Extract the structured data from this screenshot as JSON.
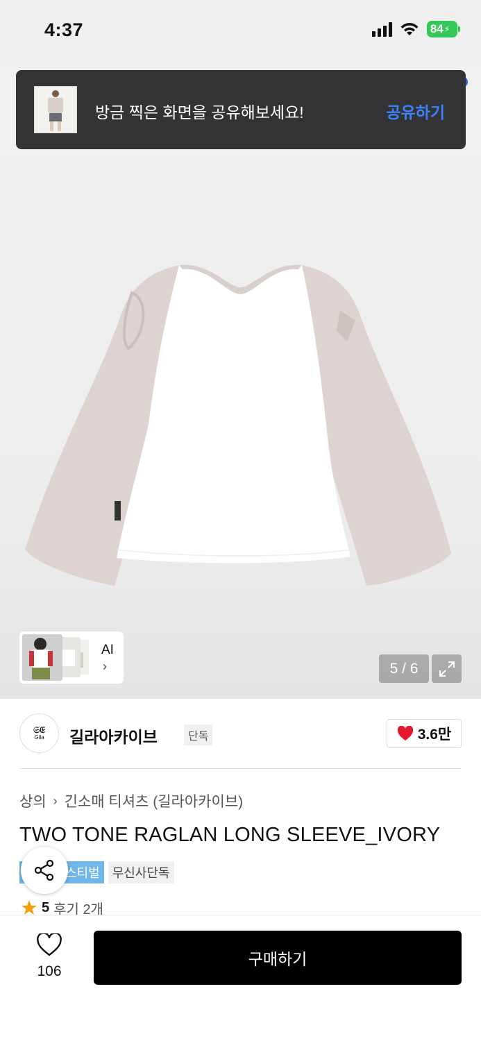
{
  "status_bar": {
    "time": "4:37",
    "battery": "84",
    "wifi_icon": "wifi-icon",
    "signal_icon": "signal-bars-icon"
  },
  "toast": {
    "message": "방금 찍은 화면을 공유해보세요!",
    "action": "공유하기"
  },
  "gallery": {
    "ai_label": "AI",
    "counter": "5 / 6",
    "expand_icon": "expand-icon"
  },
  "brand": {
    "logo_mark": "𝔖𝔈",
    "logo_sub": "Gila",
    "name": "길라아카이브",
    "tag": "단독",
    "likes": "3.6만"
  },
  "product": {
    "breadcrumb": [
      "상의",
      "긴소매 티셔츠 (길라아카이브)"
    ],
    "title": "TWO TONE RAGLAN LONG SLEEVE_IVORY",
    "tags": [
      "스티벌",
      "무신사단독"
    ],
    "rating": "5",
    "reviews": "후기 2개"
  },
  "bottom": {
    "wish_count": "106",
    "buy_label": "구매하기"
  },
  "colors": {
    "accent_blue": "#3b82f6",
    "toast_bg": "#333335",
    "like_red": "#e5172c",
    "star": "#f59e0b"
  }
}
